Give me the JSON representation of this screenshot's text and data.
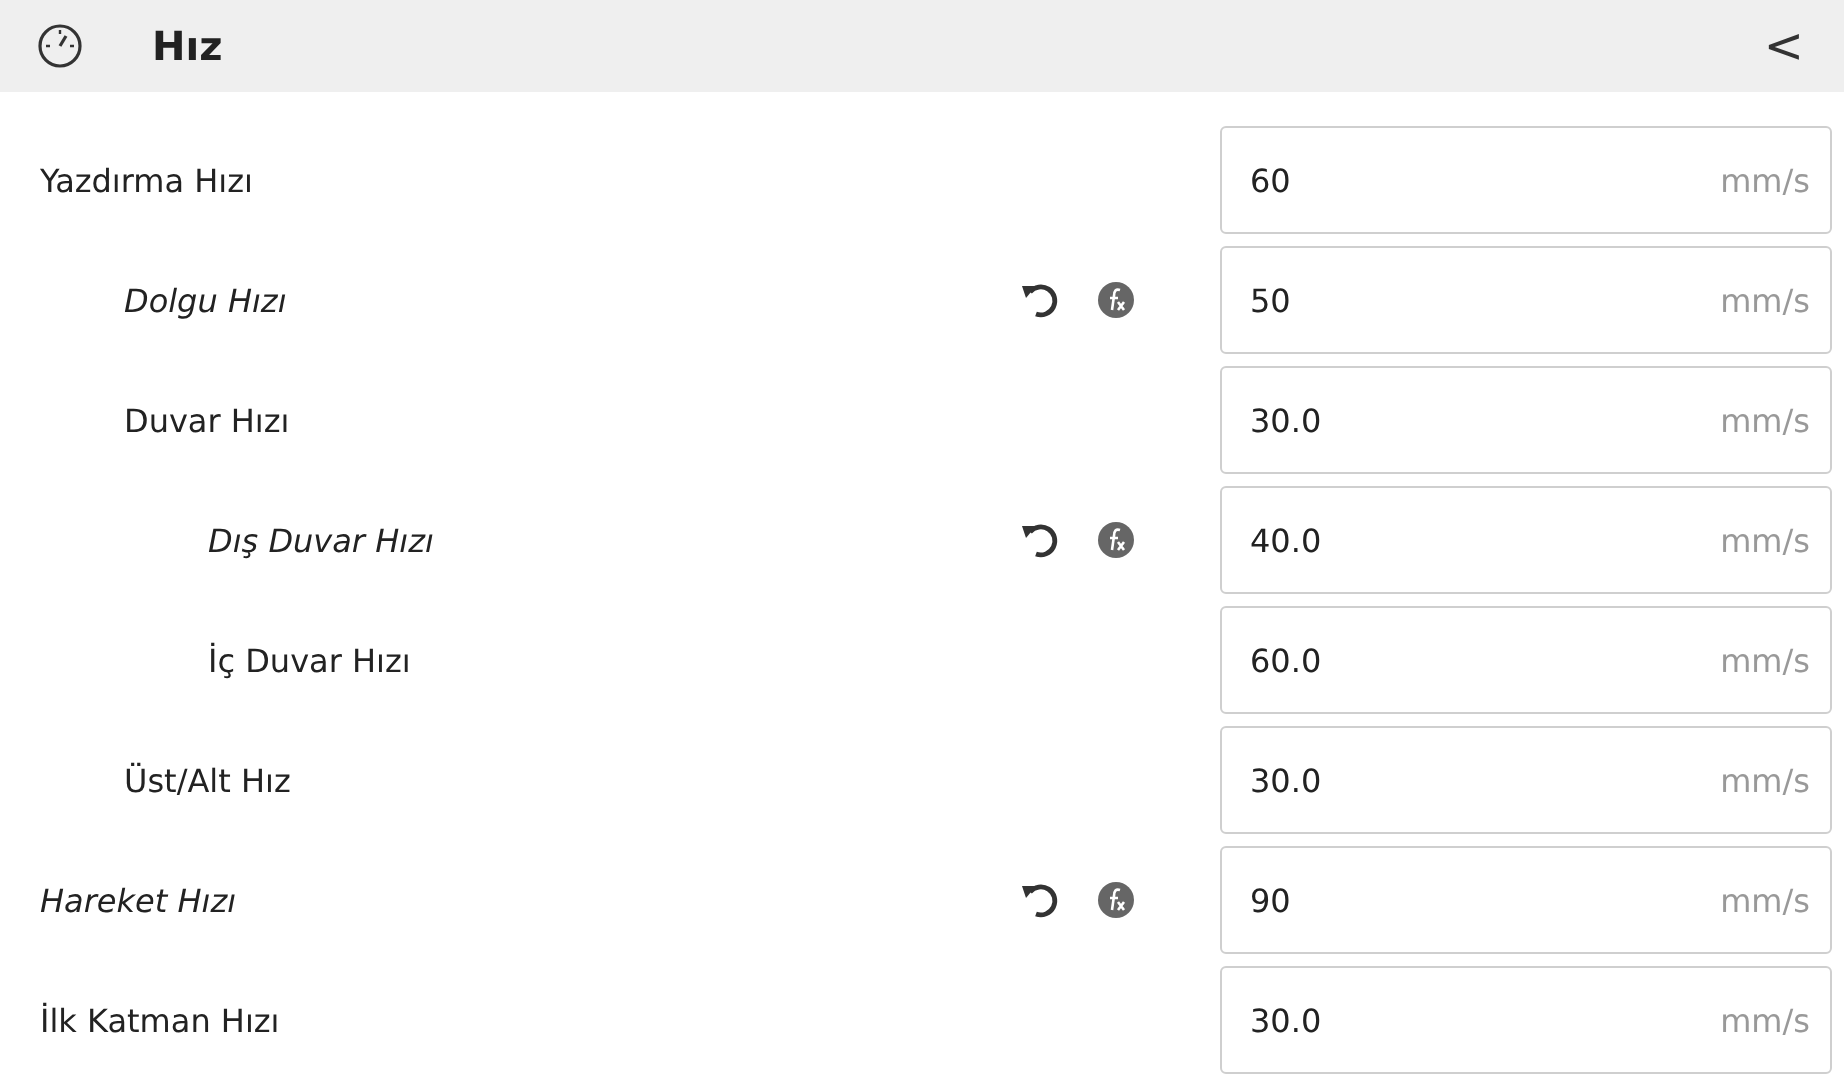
{
  "header": {
    "title": "Hız",
    "collapse_glyph": "<"
  },
  "settings": [
    {
      "label": "Yazdırma Hızı",
      "overridden": false,
      "value": "60",
      "unit": "mm/s",
      "children": [
        {
          "label": "Dolgu Hızı",
          "overridden": true,
          "value": "50",
          "unit": "mm/s"
        },
        {
          "label": "Duvar Hızı",
          "overridden": false,
          "value": "30.0",
          "unit": "mm/s",
          "children": [
            {
              "label": "Dış Duvar Hızı",
              "overridden": true,
              "value": "40.0",
              "unit": "mm/s"
            },
            {
              "label": "İç Duvar Hızı",
              "overridden": false,
              "value": "60.0",
              "unit": "mm/s"
            }
          ]
        },
        {
          "label": "Üst/Alt Hız",
          "overridden": false,
          "value": "30.0",
          "unit": "mm/s"
        }
      ]
    },
    {
      "label": "Hareket Hızı",
      "overridden": true,
      "value": "90",
      "unit": "mm/s"
    },
    {
      "label": "İlk Katman Hızı",
      "overridden": false,
      "value": "30.0",
      "unit": "mm/s"
    }
  ]
}
